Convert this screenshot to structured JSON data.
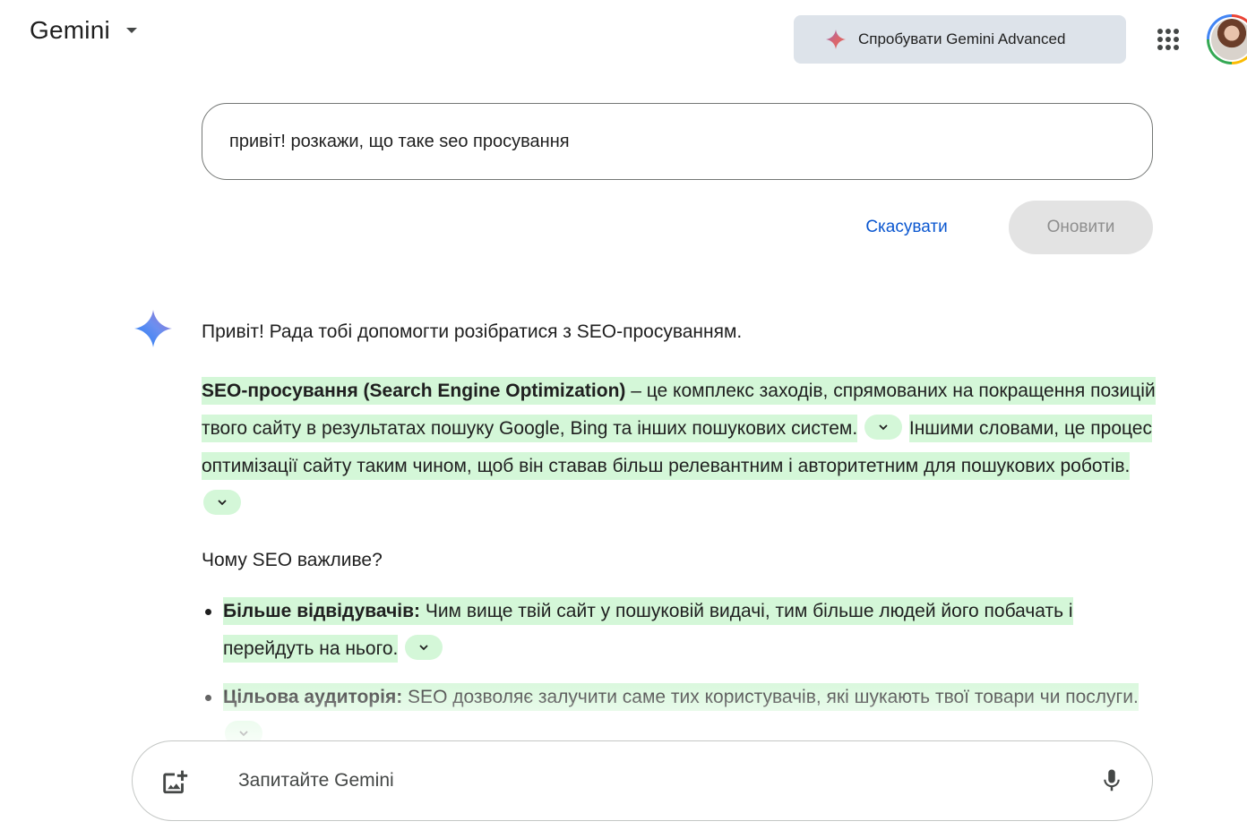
{
  "header": {
    "app_title": "Gemini",
    "try_advanced_label": "Спробувати Gemini Advanced"
  },
  "edit": {
    "prompt_text": "привіт! розкажи, що таке seo просування",
    "cancel_label": "Скасувати",
    "update_label": "Оновити"
  },
  "response": {
    "greeting": "Привіт! Рада тобі допомогти розібратися з SEO-просуванням.",
    "definition_term": "SEO-просування (Search Engine Optimization)",
    "definition_text": " – це комплекс заходів, спрямованих на покращення позицій твого сайту в результатах пошуку Google, Bing та інших пошукових систем.",
    "definition_text2": "Іншими словами, це процес оптимізації сайту таким чином, щоб він ставав більш релевантним і авторитетним для пошукових роботів.",
    "section_heading": "Чому SEO важливе?",
    "bullets": [
      {
        "term": "Більше відвідувачів:",
        "text": " Чим вище твій сайт у пошуковій видачі, тим більше людей його побачать і перейдуть на нього."
      },
      {
        "term": "Цільова аудиторія:",
        "text": " SEO дозволяє залучити саме тих користувачів, які шукають твої товари чи послуги."
      }
    ]
  },
  "input": {
    "placeholder": "Запитайте Gemini"
  },
  "colors": {
    "accent": "#0b57d0",
    "highlight": "#d4f7d8",
    "advanced_bg": "#dde3ea"
  },
  "icons": [
    "caret-down-icon",
    "gemini-spark-icon",
    "apps-grid-icon",
    "avatar",
    "gemini-logo-icon",
    "chevron-down-icon",
    "add-image-icon",
    "mic-icon"
  ]
}
